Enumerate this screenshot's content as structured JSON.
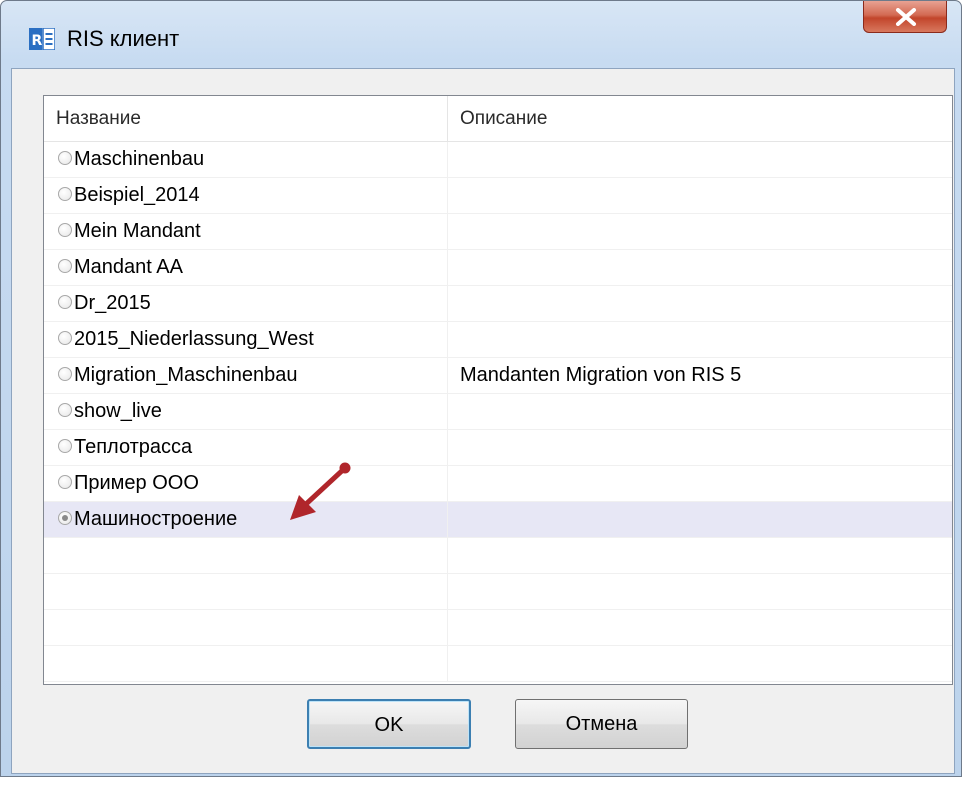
{
  "window": {
    "title": "RIS клиент",
    "icon": "ris-app-icon",
    "close_icon": "close-icon"
  },
  "table": {
    "columns": [
      "Название",
      "Описание"
    ],
    "rows": [
      {
        "name": "Maschinenbau",
        "description": ""
      },
      {
        "name": "Beispiel_2014",
        "description": ""
      },
      {
        "name": "Mein Mandant",
        "description": ""
      },
      {
        "name": "Mandant AA",
        "description": ""
      },
      {
        "name": "Dr_2015",
        "description": ""
      },
      {
        "name": "2015_Niederlassung_West",
        "description": ""
      },
      {
        "name": "Migration_Maschinenbau",
        "description": "Mandanten Migration von RIS 5"
      },
      {
        "name": "show_live",
        "description": ""
      },
      {
        "name": "Теплотрасса",
        "description": ""
      },
      {
        "name": "Пример ООО",
        "description": ""
      },
      {
        "name": "Машиностроение",
        "description": ""
      }
    ],
    "selected_index": 10,
    "empty_row_count": 4
  },
  "buttons": {
    "ok_label": "OK",
    "cancel_label": "Отмена"
  },
  "colors": {
    "selected_row": "#e7e7f5",
    "annotation_arrow": "#b0262b",
    "ok_border": "#3c7fb1",
    "close_button": "#c2452b"
  }
}
